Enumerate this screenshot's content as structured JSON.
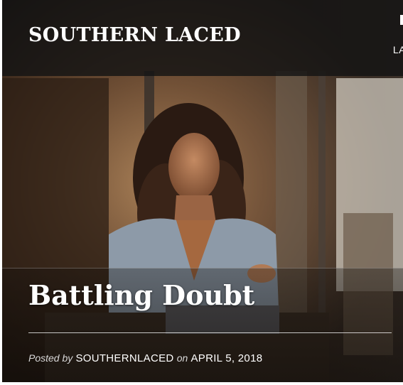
{
  "site": {
    "title": "SOUTHERN LACED",
    "nav_peek_label": "LA"
  },
  "post": {
    "title": "Battling Doubt",
    "meta": {
      "posted_by_label": "Posted by",
      "author": "SOUTHERNLACED",
      "on_label": "on",
      "date": "APRIL 5, 2018"
    }
  },
  "colors": {
    "header_bg": "#141414",
    "text": "#ffffff"
  }
}
